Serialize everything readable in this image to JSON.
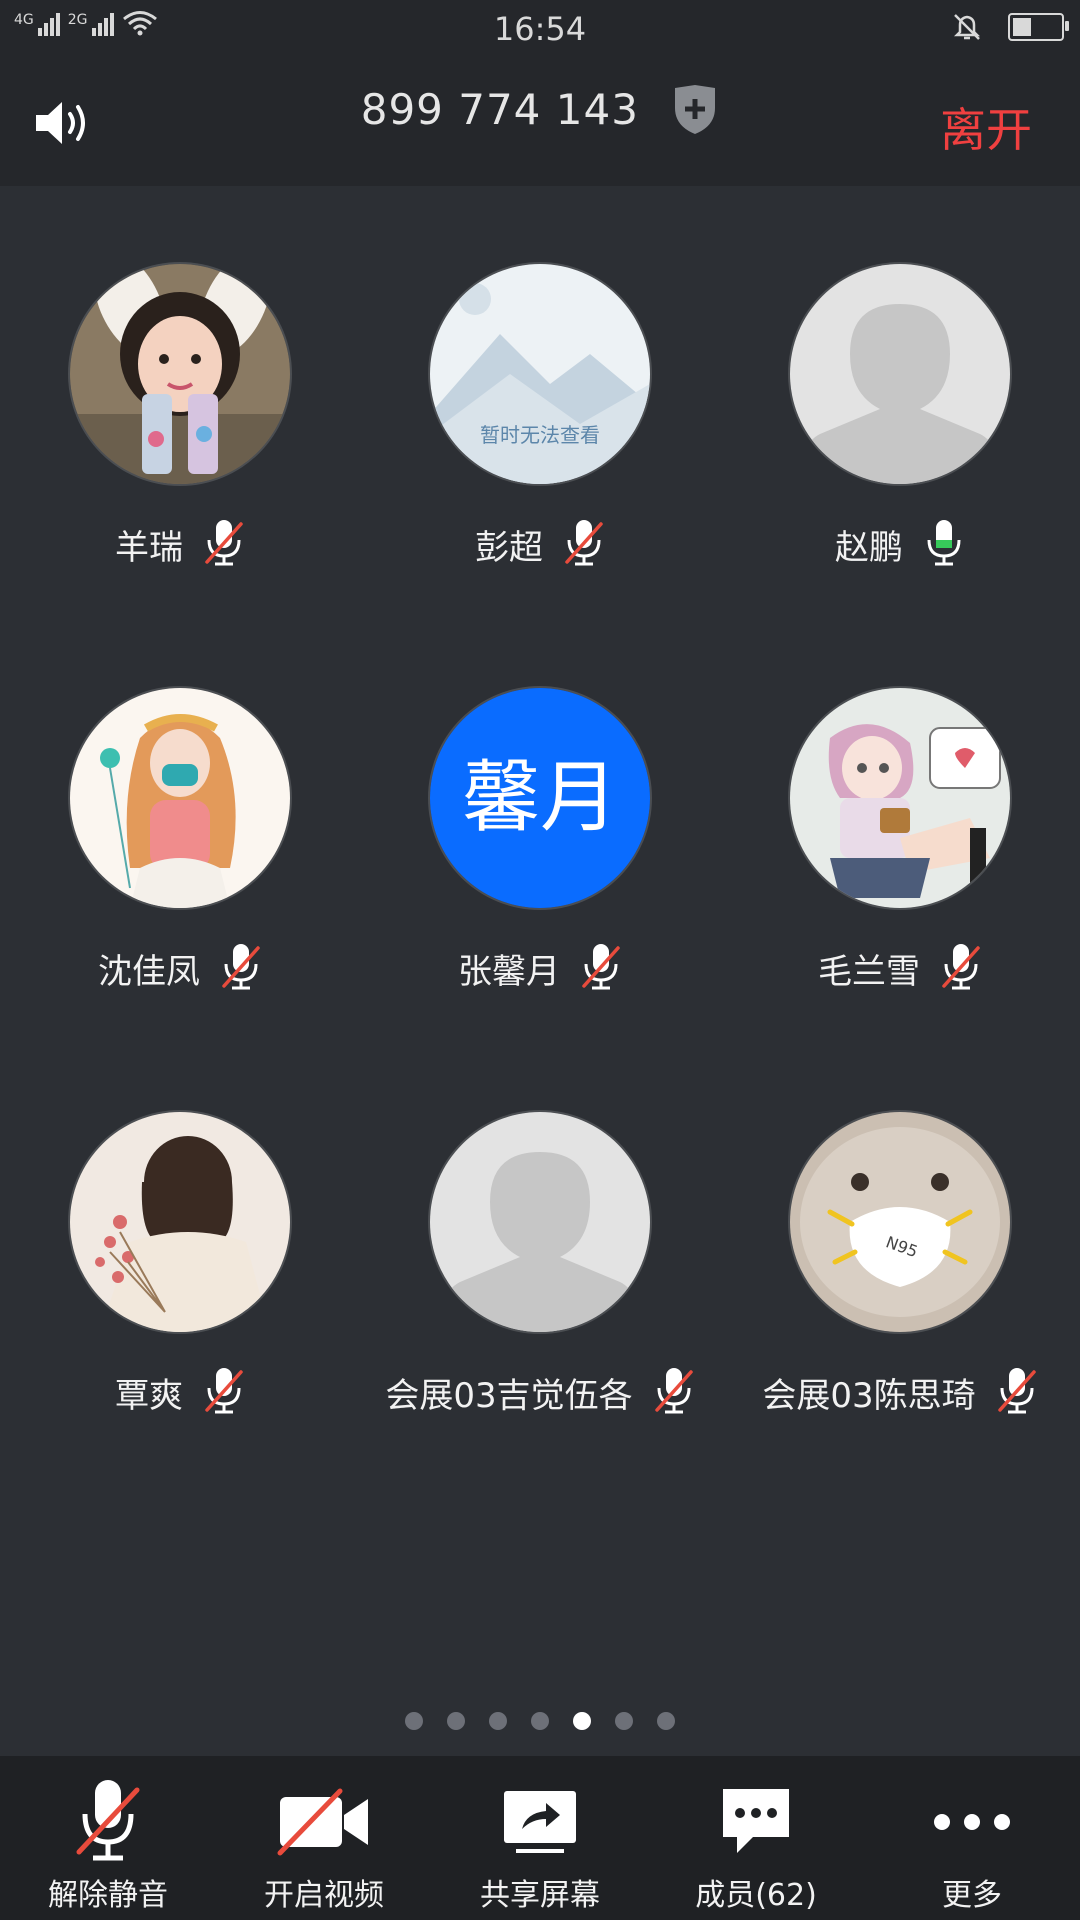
{
  "status_bar": {
    "network_1": "4G",
    "network_2": "2G",
    "time": "16:54",
    "battery_percent": 40
  },
  "header": {
    "meeting_id": "899 774 143",
    "leave_label": "离开"
  },
  "participants": [
    {
      "name": "羊瑞",
      "avatar": "photo-girl-bunny-ears",
      "muted": true
    },
    {
      "name": "彭超",
      "avatar": "placeholder-image",
      "avatar_text": "暂时无法查看",
      "muted": true
    },
    {
      "name": "赵鹏",
      "avatar": "default-silhouette",
      "muted": false
    },
    {
      "name": "沈佳凤",
      "avatar": "illustration-girl-mask",
      "muted": true
    },
    {
      "name": "张馨月",
      "avatar": "initials",
      "avatar_text": "馨月",
      "avatar_color": "#0a6cff",
      "muted": true
    },
    {
      "name": "毛兰雪",
      "avatar": "illustration-girl-sitting",
      "muted": true
    },
    {
      "name": "覃爽",
      "avatar": "photo-girl-flowers",
      "muted": true
    },
    {
      "name": "会展03吉觉伍各",
      "avatar": "default-silhouette",
      "muted": true
    },
    {
      "name": "会展03陈思琦",
      "avatar": "photo-cat-mask",
      "avatar_text": "N95",
      "muted": true
    }
  ],
  "pager": {
    "count": 7,
    "active_index": 4
  },
  "toolbar": {
    "unmute_label": "解除静音",
    "video_label": "开启视频",
    "share_label": "共享屏幕",
    "members_label": "成员(62)",
    "more_label": "更多"
  },
  "colors": {
    "background": "#2c2f34",
    "leave": "#f04040",
    "mute_slash": "#e84b3c",
    "mic_active": "#37c95a",
    "initials_avatar": "#0a6cff"
  }
}
